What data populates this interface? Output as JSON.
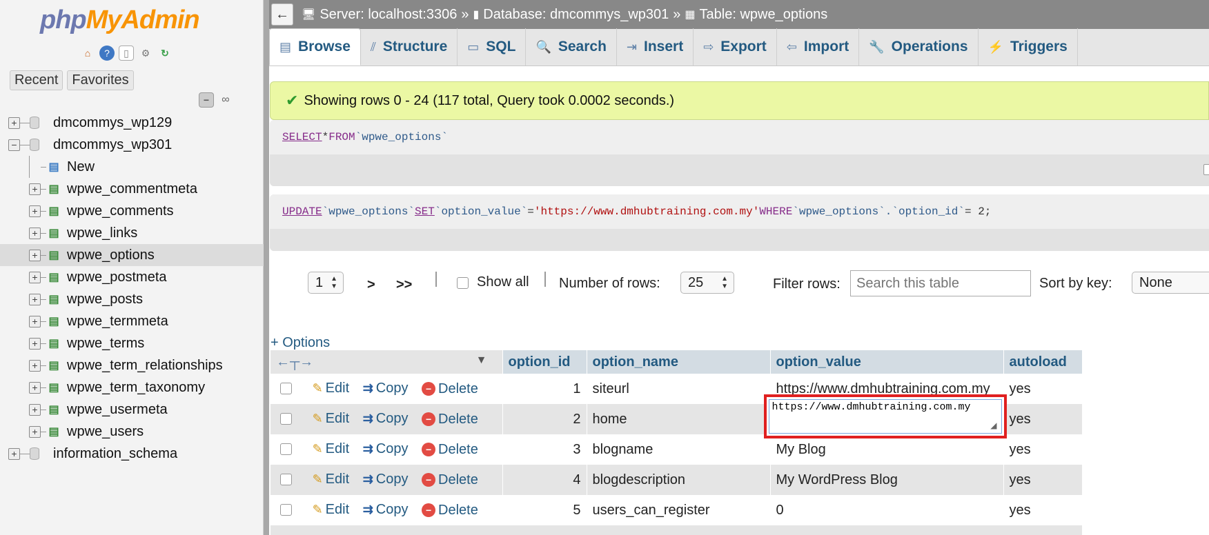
{
  "app": {
    "logo_php": "php",
    "logo_admin": "MyAdmin",
    "nav_tabs": [
      "Recent",
      "Favorites"
    ]
  },
  "nav_tree": {
    "items": [
      {
        "label": "dmcommys_wp129",
        "level": 0,
        "expander": "+"
      },
      {
        "label": "dmcommys_wp301",
        "level": 0,
        "expander": "−"
      },
      {
        "label": "New",
        "level": 1,
        "expander": ""
      },
      {
        "label": "wpwe_commentmeta",
        "level": 1,
        "expander": "+"
      },
      {
        "label": "wpwe_comments",
        "level": 1,
        "expander": "+"
      },
      {
        "label": "wpwe_links",
        "level": 1,
        "expander": "+"
      },
      {
        "label": "wpwe_options",
        "level": 1,
        "expander": "+",
        "selected": true
      },
      {
        "label": "wpwe_postmeta",
        "level": 1,
        "expander": "+"
      },
      {
        "label": "wpwe_posts",
        "level": 1,
        "expander": "+"
      },
      {
        "label": "wpwe_termmeta",
        "level": 1,
        "expander": "+"
      },
      {
        "label": "wpwe_terms",
        "level": 1,
        "expander": "+"
      },
      {
        "label": "wpwe_term_relationships",
        "level": 1,
        "expander": "+"
      },
      {
        "label": "wpwe_term_taxonomy",
        "level": 1,
        "expander": "+"
      },
      {
        "label": "wpwe_usermeta",
        "level": 1,
        "expander": "+"
      },
      {
        "label": "wpwe_users",
        "level": 1,
        "expander": "+"
      },
      {
        "label": "information_schema",
        "level": 0,
        "expander": "+"
      }
    ]
  },
  "breadcrumb": {
    "server": "Server: localhost:3306",
    "database": "Database: dmcommys_wp301",
    "table": "Table: wpwe_options",
    "separator": "»"
  },
  "tabs": [
    {
      "label": "Browse",
      "icon": "browse-icon",
      "active": true
    },
    {
      "label": "Structure",
      "icon": "structure-icon"
    },
    {
      "label": "SQL",
      "icon": "sql-icon"
    },
    {
      "label": "Search",
      "icon": "search-icon"
    },
    {
      "label": "Insert",
      "icon": "insert-icon"
    },
    {
      "label": "Export",
      "icon": "export-icon"
    },
    {
      "label": "Import",
      "icon": "import-icon"
    },
    {
      "label": "Operations",
      "icon": "operations-icon"
    },
    {
      "label": "Triggers",
      "icon": "triggers-icon"
    }
  ],
  "message": {
    "success": "Showing rows 0 - 24 (117 total, Query took 0.0002 seconds.)"
  },
  "sql1": {
    "select": "SELECT",
    "star": " * ",
    "from": "FROM",
    "table": " `wpwe_options`"
  },
  "sql2": {
    "update": "UPDATE",
    "table": " `wpwe_options` ",
    "set": "SET",
    "col": " `option_value` ",
    "eq": "= ",
    "value": "'https://www.dmhubtraining.com.my'",
    "where": " WHERE ",
    "cond": "`wpwe_options`.`option_id`",
    "rest": " = 2;"
  },
  "pager": {
    "page": "1",
    "next": ">",
    "last": ">>",
    "show_all": "Show all",
    "rows_label": "Number of rows:",
    "rows_value": "25",
    "filter_label": "Filter rows:",
    "filter_placeholder": "Search this table",
    "sort_label": "Sort by key:",
    "sort_value": "None"
  },
  "options_link": "+ Options",
  "table": {
    "columns": [
      "option_id",
      "option_name",
      "option_value",
      "autoload"
    ],
    "action_labels": {
      "edit": "Edit",
      "copy": "Copy",
      "delete": "Delete"
    },
    "rows": [
      {
        "id": "1",
        "name": "siteurl",
        "value": "https://www.dmhubtraining.com.my",
        "autoload": "yes"
      },
      {
        "id": "2",
        "name": "home",
        "value": "https://www.dmhubtraining.com.my",
        "autoload": "yes",
        "editing": true
      },
      {
        "id": "3",
        "name": "blogname",
        "value": "My Blog",
        "autoload": "yes"
      },
      {
        "id": "4",
        "name": "blogdescription",
        "value": "My WordPress Blog",
        "autoload": "yes"
      },
      {
        "id": "5",
        "name": "users_can_register",
        "value": "0",
        "autoload": "yes"
      }
    ]
  }
}
